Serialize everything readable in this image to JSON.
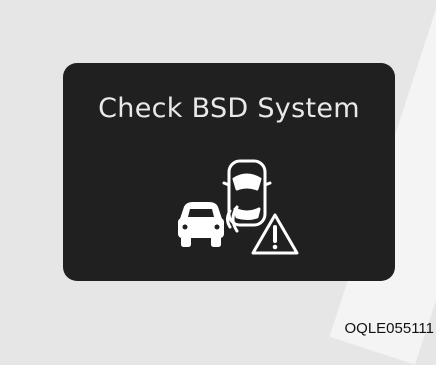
{
  "display": {
    "message": "Check BSD System"
  },
  "icons": {
    "rear_car": "car-rear-icon",
    "side_car": "car-side-icon",
    "radar": "radar-waves-icon",
    "warning": "warning-triangle-icon"
  },
  "colors": {
    "background": "#e6e6e6",
    "panel": "#202020",
    "text": "#e9e9e9",
    "icon_stroke": "#ffffff"
  },
  "caption": "OQLE055111"
}
